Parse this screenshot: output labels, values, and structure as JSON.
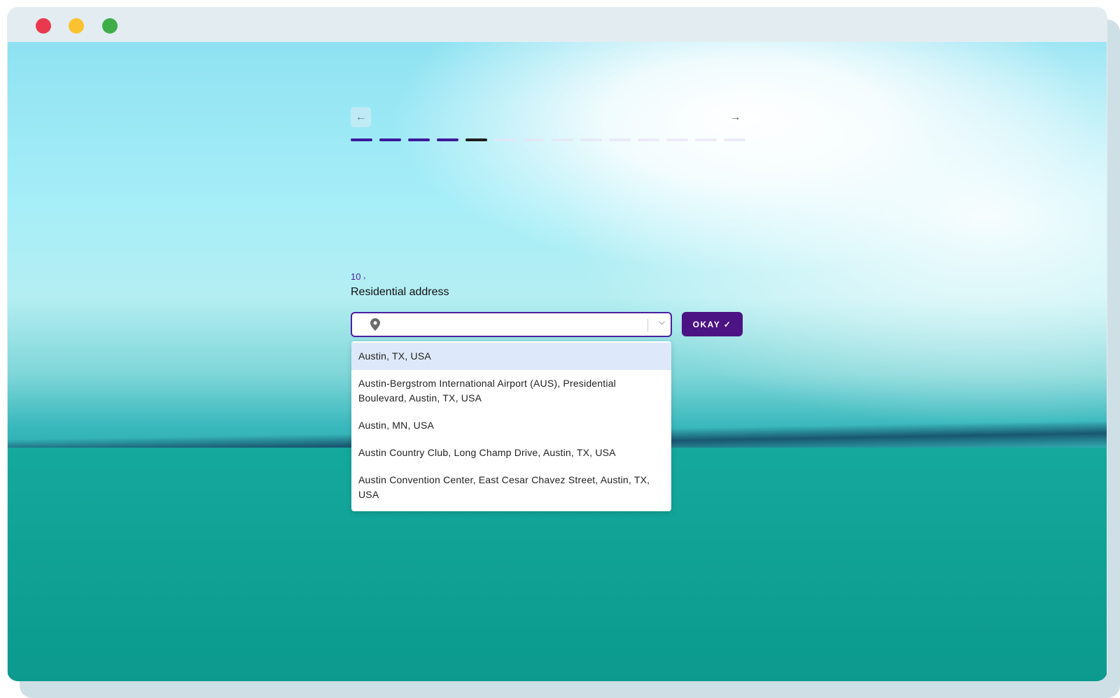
{
  "window": {
    "controls": [
      {
        "name": "close",
        "color": "#e8394f"
      },
      {
        "name": "minimize",
        "color": "#f9c22e"
      },
      {
        "name": "maximize",
        "color": "#3fae48"
      }
    ]
  },
  "nav": {
    "back_icon": "arrow-left-icon",
    "next_icon": "arrow-right-icon",
    "back_glyph": "←",
    "next_glyph": "→"
  },
  "progress": {
    "total": 14,
    "completed": 4,
    "current": 5,
    "colors": {
      "done": "#3c1a9a",
      "current": "#1e1e1e",
      "todo": "#e8e3f3"
    }
  },
  "question": {
    "number": "10",
    "arrow": "›",
    "title": "Residential address"
  },
  "input": {
    "value": "",
    "icon": "map-pin-icon",
    "chevron": "⌄"
  },
  "okay_button": {
    "label": "OKAY ✓"
  },
  "suggestions": [
    "Austin, TX, USA",
    "Austin-Bergstrom International Airport (AUS), Presidential Boulevard, Austin, TX, USA",
    "Austin, MN, USA",
    "Austin Country Club, Long Champ Drive, Austin, TX, USA",
    "Austin Convention Center, East Cesar Chavez Street, Austin, TX, USA"
  ]
}
